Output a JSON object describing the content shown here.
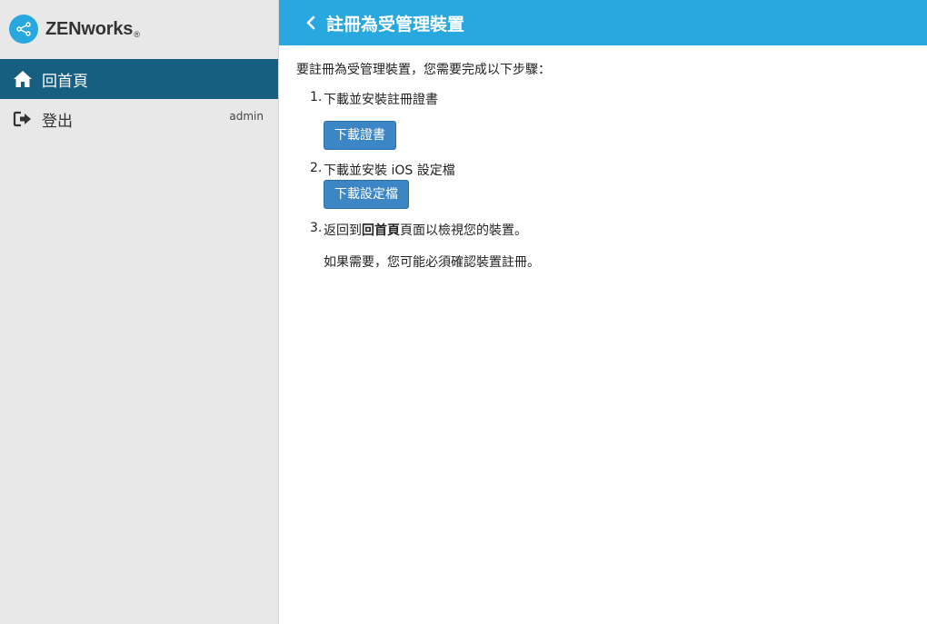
{
  "brand": {
    "name": "ZENworks",
    "reg": "®"
  },
  "sidebar": {
    "home_label": "回首頁",
    "logout_label": "登出",
    "user": "admin"
  },
  "header": {
    "title": "註冊為受管理裝置"
  },
  "content": {
    "intro": "要註冊為受管理裝置，您需要完成以下步驟：",
    "step1": {
      "num": "1.",
      "text": "下載並安裝註冊證書",
      "button": "下載證書"
    },
    "step2": {
      "num": "2.",
      "text": "下載並安裝 iOS 設定檔",
      "button": "下載設定檔"
    },
    "step3": {
      "num": "3.",
      "pre": "返回到",
      "bold": "回首頁",
      "post": "頁面以檢視您的裝置。"
    },
    "note": "如果需要，您可能必須確認裝置註冊。"
  },
  "colors": {
    "accent": "#29a8e0",
    "nav_active": "#175f80",
    "button": "#3d86c6",
    "sidebar_bg": "#e8e8e8"
  },
  "icons": {
    "logo": "share-icon",
    "home": "home-icon",
    "logout": "sign-out-icon",
    "back": "chevron-left-icon"
  }
}
